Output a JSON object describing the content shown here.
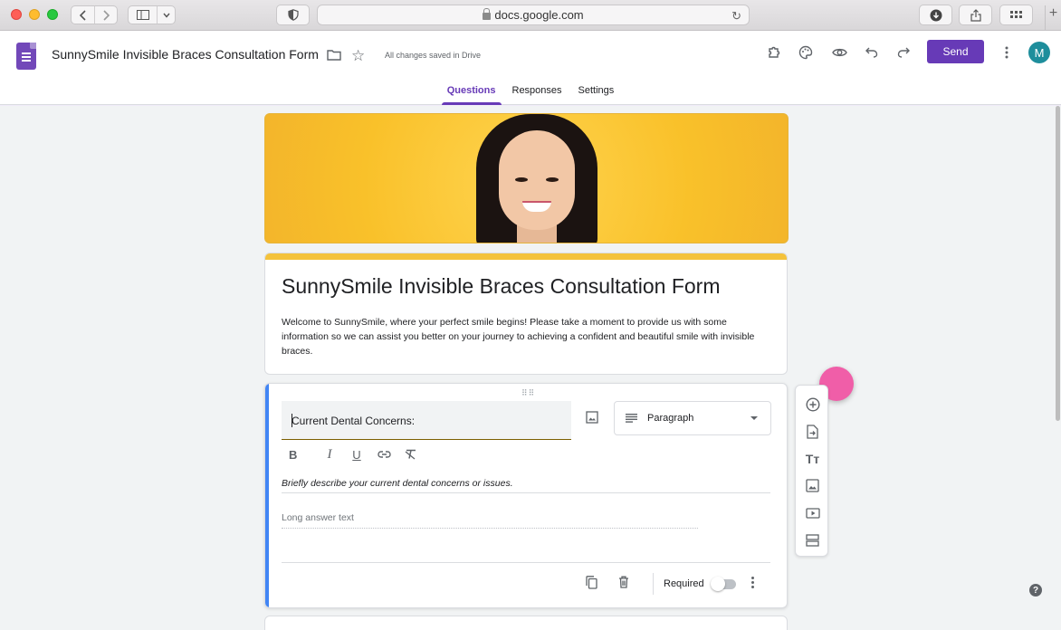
{
  "browser": {
    "url": "docs.google.com"
  },
  "header": {
    "doc_title": "SunnySmile Invisible Braces Consultation Form",
    "saved_status": "All changes saved in Drive",
    "send_label": "Send",
    "avatar_initial": "M",
    "accent_color": "#673ab7"
  },
  "tabs": [
    {
      "label": "Questions",
      "active": true
    },
    {
      "label": "Responses",
      "active": false
    },
    {
      "label": "Settings",
      "active": false
    }
  ],
  "form": {
    "title": "SunnySmile Invisible Braces Consultation Form",
    "description": "Welcome to SunnySmile, where your perfect smile begins! Please take a moment to provide us with some information so we can assist you better on your journey to achieving a confident and beautiful smile with invisible braces."
  },
  "question": {
    "title": "Current Dental Concerns:",
    "type": "Paragraph",
    "description": "Briefly describe your current dental concerns or issues.",
    "answer_placeholder": "Long answer text",
    "required_label": "Required",
    "required": false
  },
  "help": {
    "glyph": "?"
  }
}
